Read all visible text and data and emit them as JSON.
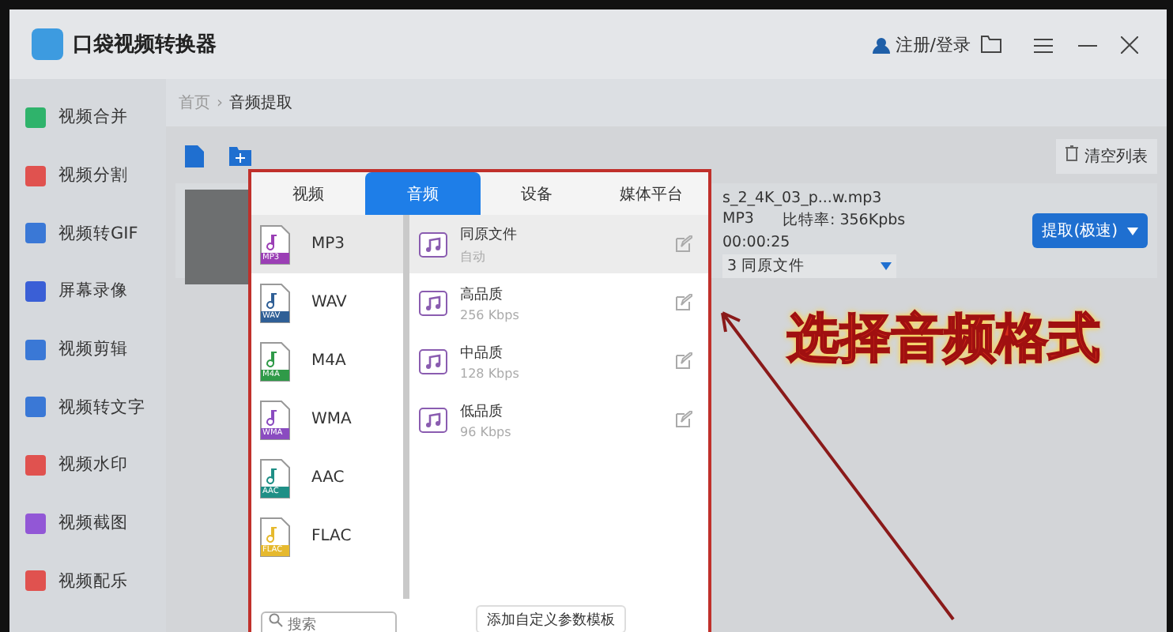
{
  "app": {
    "title": "口袋视频转换器",
    "login": "注册/登录"
  },
  "sidebar": {
    "items": [
      {
        "label": "视频合并",
        "color": "#2fb36b"
      },
      {
        "label": "视频分割",
        "color": "#e0524f"
      },
      {
        "label": "视频转GIF",
        "color": "#3a78d6"
      },
      {
        "label": "屏幕录像",
        "color": "#3a5fd6"
      },
      {
        "label": "视频剪辑",
        "color": "#3a78d6"
      },
      {
        "label": "视频转文字",
        "color": "#3a78d6"
      },
      {
        "label": "视频水印",
        "color": "#e0524f"
      },
      {
        "label": "视频截图",
        "color": "#9257d6"
      },
      {
        "label": "视频配乐",
        "color": "#e0524f"
      }
    ]
  },
  "breadcrumb": {
    "home": "首页",
    "separator": "›",
    "current": "音频提取"
  },
  "toolbar": {
    "clear_button": "清空列表"
  },
  "file": {
    "name": "s_2_4K_03_p...w.mp3",
    "format": "MP3",
    "bitrate": "比特率: 356Kpbs",
    "duration": "00:00:25",
    "preset": "3 同原文件",
    "action": "提取(极速)"
  },
  "popup": {
    "tabs": [
      {
        "label": "视频",
        "selected": false
      },
      {
        "label": "音频",
        "selected": true
      },
      {
        "label": "设备",
        "selected": false
      },
      {
        "label": "媒体平台",
        "selected": false
      }
    ],
    "formats": [
      {
        "label": "MP3",
        "tag": "MP3",
        "color": "#9b3fb5",
        "selected": true
      },
      {
        "label": "WAV",
        "tag": "WAV",
        "color": "#2f5f96",
        "selected": false
      },
      {
        "label": "M4A",
        "tag": "M4A",
        "color": "#2f9a48",
        "selected": false
      },
      {
        "label": "WMA",
        "tag": "WMA",
        "color": "#8a4bc0",
        "selected": false
      },
      {
        "label": "AAC",
        "tag": "AAC",
        "color": "#1f8f86",
        "selected": false
      },
      {
        "label": "FLAC",
        "tag": "FLAC",
        "color": "#e6b92e",
        "selected": false
      }
    ],
    "qualities": [
      {
        "name": "同原文件",
        "detail": "自动",
        "selected": true
      },
      {
        "name": "高品质",
        "detail": "256 Kbps",
        "selected": false
      },
      {
        "name": "中品质",
        "detail": "128 Kbps",
        "selected": false
      },
      {
        "name": "低品质",
        "detail": "96 Kbps",
        "selected": false
      }
    ],
    "search": {
      "placeholder": "搜索"
    },
    "add_button": "添加自定义参数模板"
  },
  "annotation": {
    "text": "选择音频格式"
  }
}
